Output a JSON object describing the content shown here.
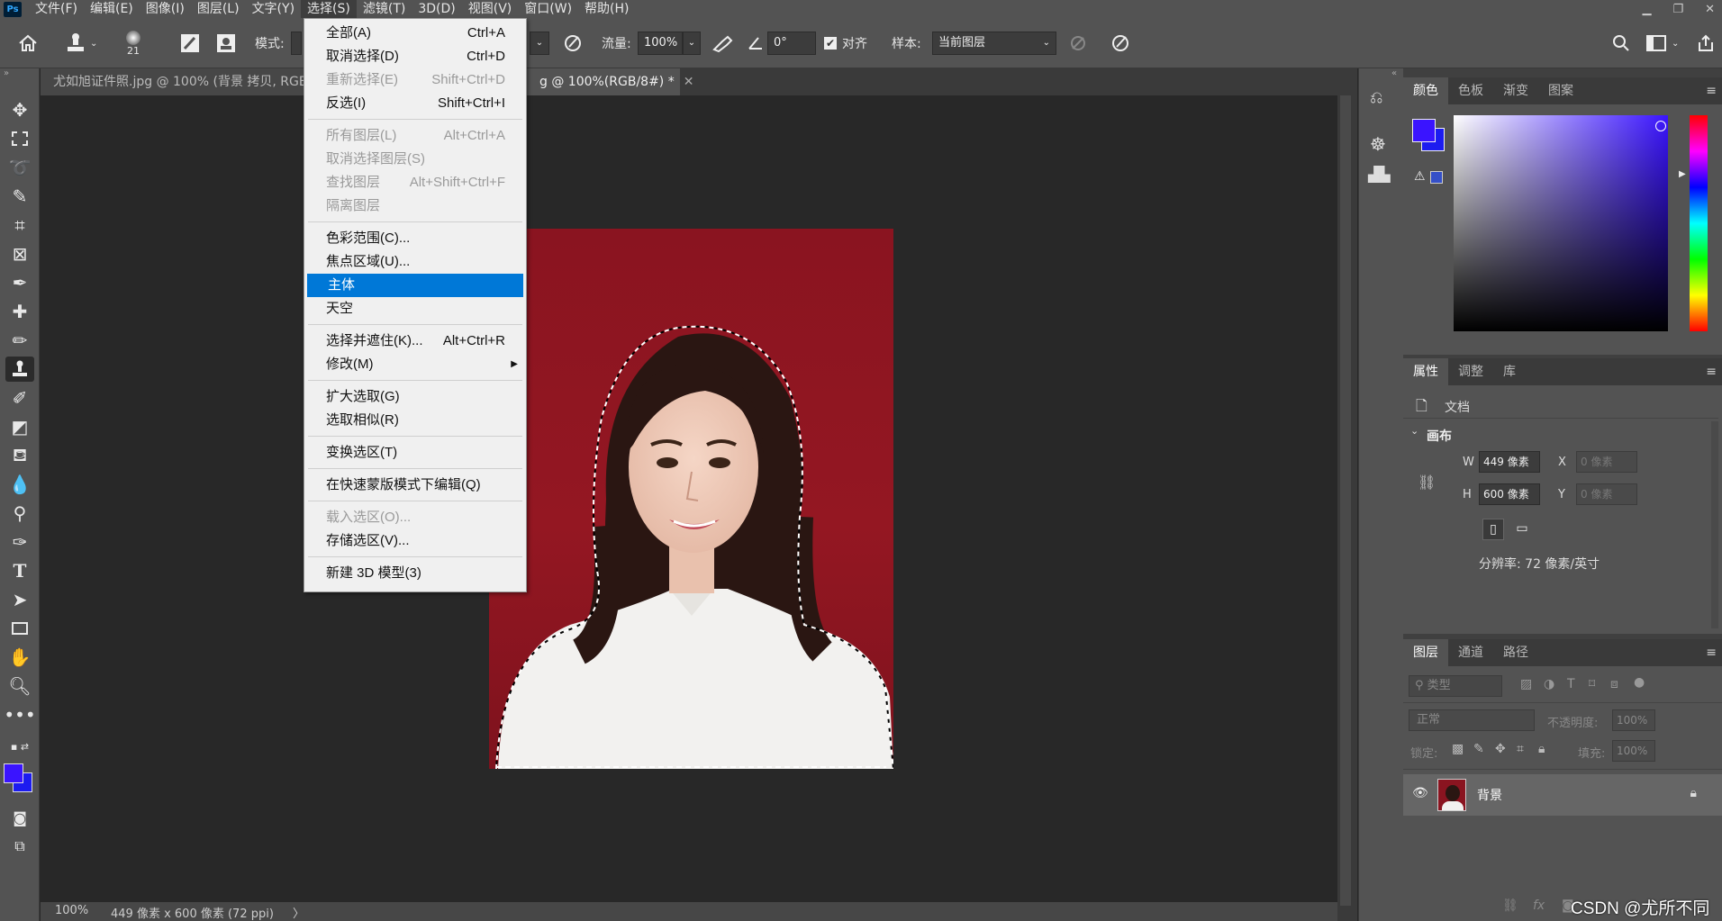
{
  "menubar": {
    "logo": "Ps",
    "items": [
      "文件(F)",
      "编辑(E)",
      "图像(I)",
      "图层(L)",
      "文字(Y)",
      "选择(S)",
      "滤镜(T)",
      "3D(D)",
      "视图(V)",
      "窗口(W)",
      "帮助(H)"
    ],
    "open_index": 5,
    "window_controls": [
      "▁",
      "❐",
      "✕"
    ]
  },
  "options": {
    "brush_size": "21",
    "mode_label": "模式:",
    "flow_label": "流量:",
    "flow_value": "100%",
    "angle_value": "0°",
    "align_label": "对齐",
    "sample_label": "样本:",
    "sample_value": "当前图层"
  },
  "tabs": [
    {
      "label": "尤如旭证件照.jpg @ 100% (背景 拷贝, RGB"
    },
    {
      "label": "g @ 100%(RGB/8#) *"
    }
  ],
  "dropdown": {
    "items": [
      {
        "label": "全部(A)",
        "shortcut": "Ctrl+A",
        "disabled": false
      },
      {
        "label": "取消选择(D)",
        "shortcut": "Ctrl+D",
        "disabled": false
      },
      {
        "label": "重新选择(E)",
        "shortcut": "Shift+Ctrl+D",
        "disabled": true
      },
      {
        "label": "反选(I)",
        "shortcut": "Shift+Ctrl+I",
        "disabled": false
      },
      {
        "sep": true
      },
      {
        "label": "所有图层(L)",
        "shortcut": "Alt+Ctrl+A",
        "disabled": true
      },
      {
        "label": "取消选择图层(S)",
        "shortcut": "",
        "disabled": true
      },
      {
        "label": "查找图层",
        "shortcut": "Alt+Shift+Ctrl+F",
        "disabled": true
      },
      {
        "label": "隔离图层",
        "shortcut": "",
        "disabled": true
      },
      {
        "sep": true
      },
      {
        "label": "色彩范围(C)...",
        "shortcut": "",
        "disabled": false
      },
      {
        "label": "焦点区域(U)...",
        "shortcut": "",
        "disabled": false
      },
      {
        "label": "主体",
        "shortcut": "",
        "disabled": false,
        "highlight": true
      },
      {
        "label": "天空",
        "shortcut": "",
        "disabled": false
      },
      {
        "sep": true
      },
      {
        "label": "选择并遮住(K)...",
        "shortcut": "Alt+Ctrl+R",
        "disabled": false
      },
      {
        "label": "修改(M)",
        "shortcut": "",
        "disabled": false,
        "submenu": true
      },
      {
        "sep": true
      },
      {
        "label": "扩大选取(G)",
        "shortcut": "",
        "disabled": false
      },
      {
        "label": "选取相似(R)",
        "shortcut": "",
        "disabled": false
      },
      {
        "sep": true
      },
      {
        "label": "变换选区(T)",
        "shortcut": "",
        "disabled": false
      },
      {
        "sep": true
      },
      {
        "label": "在快速蒙版模式下编辑(Q)",
        "shortcut": "",
        "disabled": false
      },
      {
        "sep": true
      },
      {
        "label": "载入选区(O)...",
        "shortcut": "",
        "disabled": true
      },
      {
        "label": "存储选区(V)...",
        "shortcut": "",
        "disabled": false
      },
      {
        "sep": true
      },
      {
        "label": "新建 3D 模型(3)",
        "shortcut": "",
        "disabled": false
      }
    ]
  },
  "status": {
    "zoom": "100%",
    "doc_info": "449 像素 x 600 像素 (72 ppi)",
    "arrow": "〉"
  },
  "color_panel": {
    "tabs": [
      "颜色",
      "色板",
      "渐变",
      "图案"
    ],
    "fg": "#3a14ff",
    "bg": "#1c1cf0"
  },
  "properties": {
    "tabs": [
      "属性",
      "调整",
      "库"
    ],
    "doc_label": "文档",
    "section": "画布",
    "w_label": "W",
    "w_value": "449 像素",
    "h_label": "H",
    "h_value": "600 像素",
    "x_label": "X",
    "x_placeholder": "0 像素",
    "y_label": "Y",
    "y_placeholder": "0 像素",
    "resolution": "分辨率: 72 像素/英寸"
  },
  "layers": {
    "tabs": [
      "图层",
      "通道",
      "路径"
    ],
    "filter_placeholder": "类型",
    "blend": "正常",
    "opacity_label": "不透明度:",
    "opacity_value": "100%",
    "lock_label": "锁定:",
    "fill_label": "填充:",
    "fill_value": "100%",
    "layer_name": "背景"
  },
  "watermark": "CSDN @尤所不同"
}
